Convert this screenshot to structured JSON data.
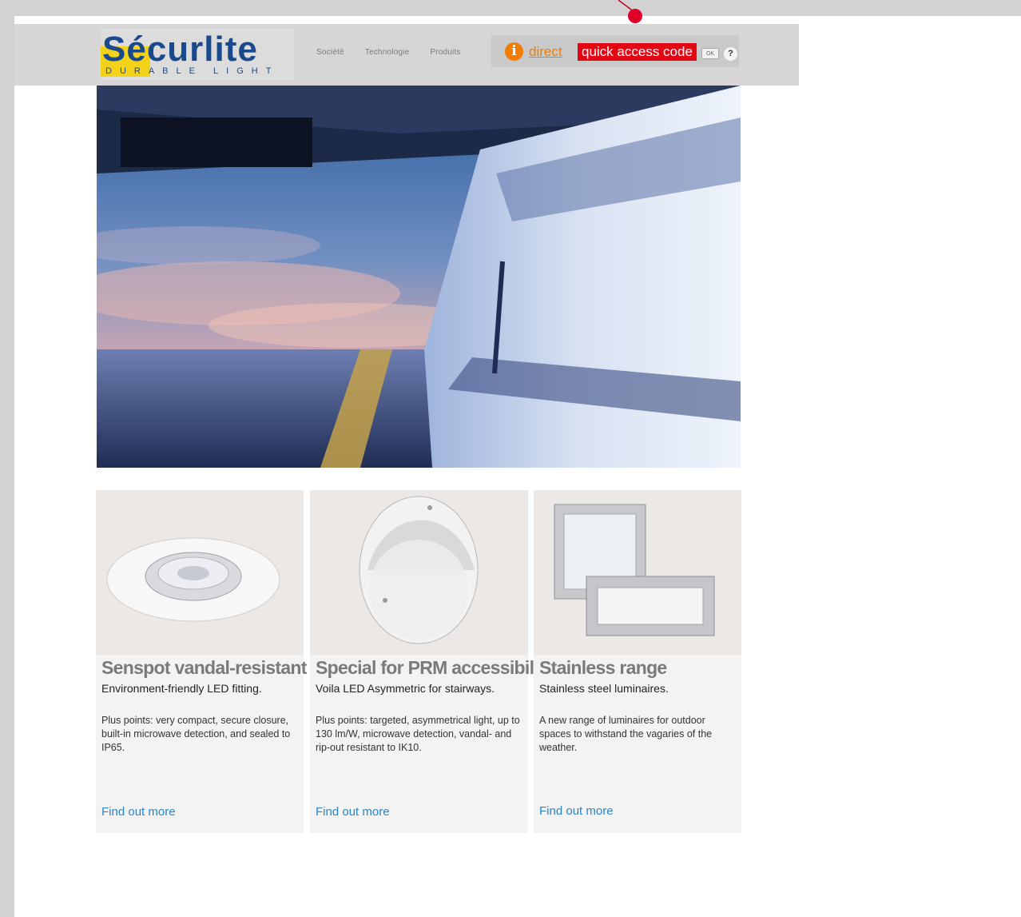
{
  "brand": {
    "name": "Sécurlite",
    "tagline": "DURABLE LIGHT"
  },
  "nav": {
    "items": [
      "Société",
      "Technologie",
      "Produits"
    ]
  },
  "access": {
    "info_label": "i",
    "direct_label": "direct",
    "quick_access_label": "quick access code",
    "ok_label": "OK",
    "help_label": "?"
  },
  "colors": {
    "brand_blue": "#1b4a8c",
    "brand_yellow": "#f5d21a",
    "accent_orange": "#f07d00",
    "accent_red": "#e30613",
    "link_blue": "#2a86c8"
  },
  "cards": [
    {
      "title": "Senspot vandal-resistant",
      "subtitle": "Environment-friendly LED fitting.",
      "description": "Plus points: very compact, secure closure, built-in microwave detection, and sealed to IP65.",
      "link": "Find out more"
    },
    {
      "title": "Special for PRM accessibility",
      "subtitle": "Voila LED Asymmetric for stairways.",
      "description": "Plus points: targeted, asymmetrical light, up to 130 lm/W, microwave detection, vandal- and rip-out resistant to IK10.",
      "link": "Find out more"
    },
    {
      "title": "Stainless range",
      "subtitle": "Stainless steel luminaires.",
      "description": "A new range of luminaires for outdoor spaces to withstand the vagaries of the weather.",
      "link": "Find out more"
    }
  ]
}
